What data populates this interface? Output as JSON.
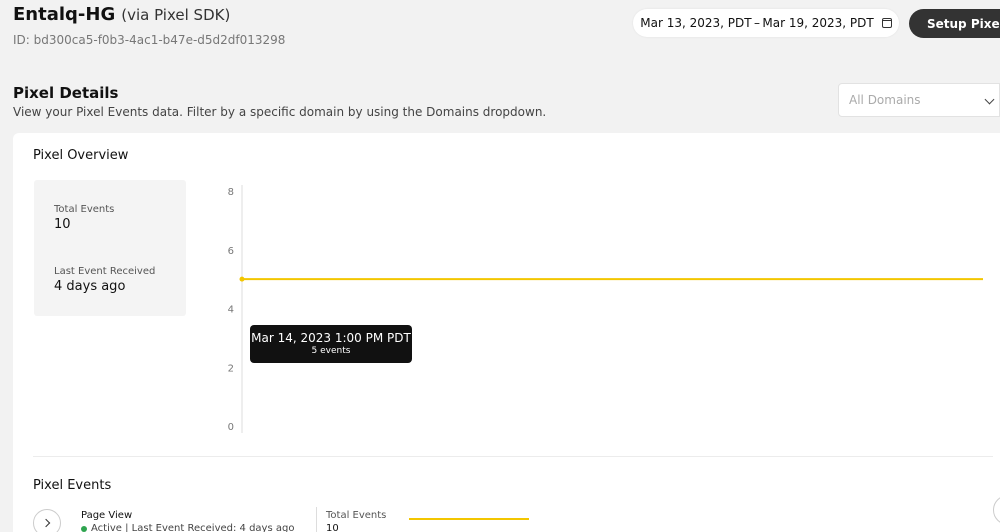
{
  "header": {
    "title": "Entalq-HG",
    "subtitle": "(via Pixel SDK)",
    "pixel_id": "ID: bd300ca5-f0b3-4ac1-b47e-d5d2df013298"
  },
  "date_range": {
    "label": "Mar 13, 2023, PDT – Mar 19, 2023, PDT",
    "icon": "calendar-icon"
  },
  "setup_button": {
    "label": "Setup Pixel"
  },
  "details": {
    "title": "Pixel Details",
    "description": "View your Pixel Events data. Filter by a specific domain by using the Domains dropdown."
  },
  "domains_dropdown": {
    "placeholder": "All Domains",
    "icon": "chevron-down-icon"
  },
  "overview": {
    "title": "Pixel Overview",
    "stats": [
      {
        "label": "Total Events",
        "value": "10"
      },
      {
        "label": "Last Event Received",
        "value": "4 days ago"
      }
    ],
    "tooltip": {
      "title": "Mar 14, 2023 1:00 PM PDT",
      "subtitle": "5 events"
    }
  },
  "chart_data": {
    "type": "line",
    "title": "",
    "xlabel": "",
    "ylabel": "",
    "y_ticks": [
      "0",
      "2",
      "4",
      "6",
      "8"
    ],
    "ylim": [
      0,
      8
    ],
    "series": [
      {
        "points": [
          {
            "x": "Mar 14, 2023 1:00 PM PDT",
            "y": 5
          },
          {
            "y": 5
          }
        ]
      }
    ],
    "line_color": "#f3c600",
    "grid": false
  },
  "events": {
    "title": "Pixel Events",
    "items": [
      {
        "name": "Page View",
        "status": "Active | Last Event Received: 4 days ago",
        "status_color": "#2ea44f",
        "total_label": "Total Events",
        "total_value": "10"
      }
    ]
  },
  "colors": {
    "accent": "#f3c600",
    "button_bg": "#333333",
    "active": "#2ea44f"
  }
}
